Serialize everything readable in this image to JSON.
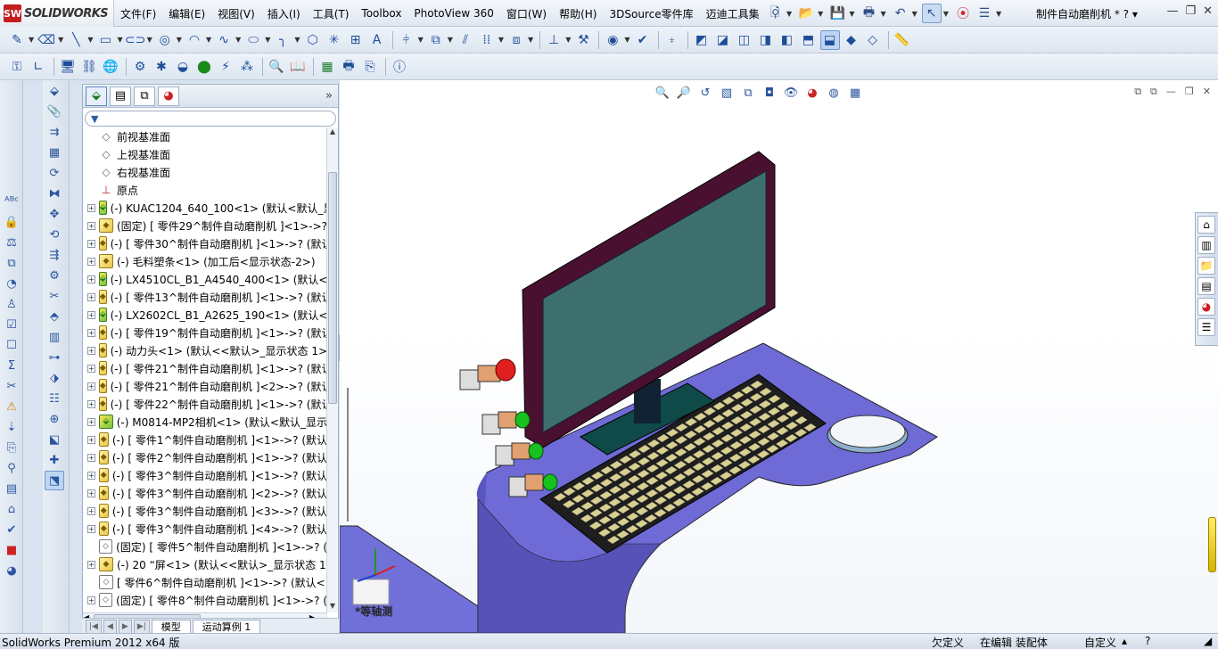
{
  "app": {
    "logo_mark": "SW",
    "logo_text": "SOLIDWORKS",
    "doc_title": "制件自动磨削机 *",
    "help": "?"
  },
  "menu": [
    "文件(F)",
    "编辑(E)",
    "视图(V)",
    "插入(I)",
    "工具(T)",
    "Toolbox",
    "PhotoView 360",
    "窗口(W)",
    "帮助(H)",
    "3DSource零件库",
    "迈迪工具集"
  ],
  "window_buttons": [
    "—",
    "❐",
    "✕"
  ],
  "viewport_window_buttons": [
    "⧉",
    "⧉",
    "—",
    "❐",
    "✕"
  ],
  "panel": {
    "expand": "»",
    "filter": "▼"
  },
  "tree": [
    {
      "pm": "",
      "icon": "plane",
      "text": "前视基准面"
    },
    {
      "pm": "",
      "icon": "plane",
      "text": "上视基准面"
    },
    {
      "pm": "",
      "icon": "plane",
      "text": "右视基准面"
    },
    {
      "pm": "",
      "icon": "origin",
      "text": "原点"
    },
    {
      "pm": "+",
      "icon": "asm",
      "text": "(-) KUAC1204_640_100<1> (默认<默认_显"
    },
    {
      "pm": "+",
      "icon": "part",
      "text": "(固定) [ 零件29^制件自动磨削机 ]<1>->?"
    },
    {
      "pm": "+",
      "icon": "part",
      "text": "(-) [ 零件30^制件自动磨削机 ]<1>->? (默认"
    },
    {
      "pm": "+",
      "icon": "part",
      "text": "(-) 毛料塑条<1> (加工后<显示状态-2>)"
    },
    {
      "pm": "+",
      "icon": "asm",
      "text": "(-) LX4510CL_B1_A4540_400<1> (默认<显"
    },
    {
      "pm": "+",
      "icon": "part",
      "text": "(-) [ 零件13^制件自动磨削机 ]<1>->? (默认"
    },
    {
      "pm": "+",
      "icon": "asm",
      "text": "(-) LX2602CL_B1_A2625_190<1> (默认<显"
    },
    {
      "pm": "+",
      "icon": "part",
      "text": "(-) [ 零件19^制件自动磨削机 ]<1>->? (默认"
    },
    {
      "pm": "+",
      "icon": "part",
      "text": "(-) 动力头<1> (默认<<默认>_显示状态 1>"
    },
    {
      "pm": "+",
      "icon": "part",
      "text": "(-) [ 零件21^制件自动磨削机 ]<1>->? (默认"
    },
    {
      "pm": "+",
      "icon": "part",
      "text": "(-) [ 零件21^制件自动磨削机 ]<2>->? (默认"
    },
    {
      "pm": "+",
      "icon": "part",
      "text": "(-) [ 零件22^制件自动磨削机 ]<1>->? (默认"
    },
    {
      "pm": "+",
      "icon": "asm",
      "text": "(-) M0814-MP2相机<1> (默认<默认_显示"
    },
    {
      "pm": "+",
      "icon": "part",
      "text": "(-) [ 零件1^制件自动磨削机 ]<1>->? (默认"
    },
    {
      "pm": "+",
      "icon": "part",
      "text": "(-) [ 零件2^制件自动磨削机 ]<1>->? (默认"
    },
    {
      "pm": "+",
      "icon": "part",
      "text": "(-) [ 零件3^制件自动磨削机 ]<1>->? (默认"
    },
    {
      "pm": "+",
      "icon": "part",
      "text": "(-) [ 零件3^制件自动磨削机 ]<2>->? (默认"
    },
    {
      "pm": "+",
      "icon": "part",
      "text": "(-) [ 零件3^制件自动磨削机 ]<3>->? (默认"
    },
    {
      "pm": "+",
      "icon": "part",
      "text": "(-) [ 零件3^制件自动磨削机 ]<4>->? (默认"
    },
    {
      "pm": "",
      "icon": "wire",
      "text": "(固定) [ 零件5^制件自动磨削机 ]<1>->? ("
    },
    {
      "pm": "+",
      "icon": "part",
      "text": "(-) 20 “屏<1> (默认<<默认>_显示状态 1"
    },
    {
      "pm": "",
      "icon": "wire",
      "text": "[ 零件6^制件自动磨削机 ]<1>->? (默认<"
    },
    {
      "pm": "+",
      "icon": "wire",
      "text": "(固定) [ 零件8^制件自动磨削机 ]<1>->? ("
    }
  ],
  "bottom_tabs": [
    "模型",
    "运动算例 1"
  ],
  "iso_label": "*等轴测",
  "status": {
    "left": "SolidWorks Premium 2012 x64 版",
    "under": "欠定义",
    "mode": "在编辑 装配体",
    "custom": "自定义",
    "help": "?"
  }
}
